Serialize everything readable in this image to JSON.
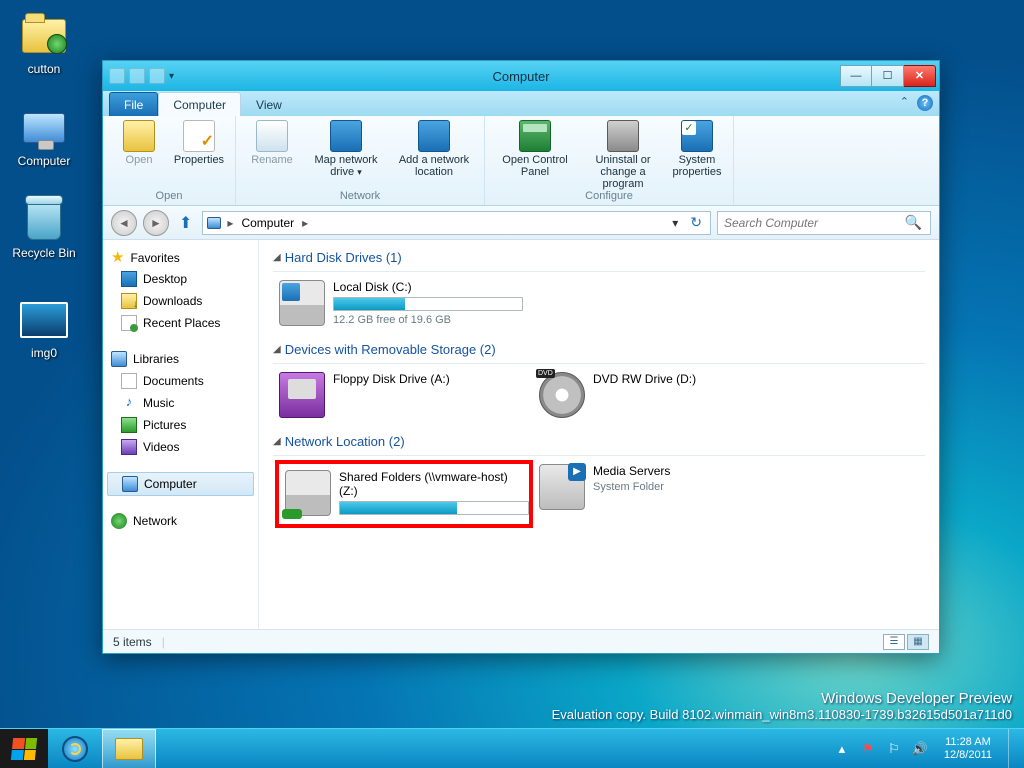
{
  "desktop": {
    "icons": [
      "cutton",
      "Computer",
      "Recycle Bin",
      "img0"
    ]
  },
  "watermark": {
    "line1": "Windows Developer Preview",
    "line2": "Evaluation copy. Build 8102.winmain_win8m3.110830-1739.b32615d501a711d0"
  },
  "taskbar": {
    "time": "11:28 AM",
    "date": "12/8/2011"
  },
  "window": {
    "title": "Computer",
    "tabs": {
      "file": "File",
      "computer": "Computer",
      "view": "View"
    },
    "ribbon": {
      "open_group": "Open",
      "open": "Open",
      "properties": "Properties",
      "rename": "Rename",
      "network_group": "Network",
      "map_drive": "Map network drive",
      "add_loc": "Add a network location",
      "configure_group": "Configure",
      "control_panel": "Open Control Panel",
      "uninstall": "Uninstall or change a program",
      "sys_props": "System properties"
    },
    "address": {
      "root": "Computer"
    },
    "search_placeholder": "Search Computer",
    "sidebar": {
      "favorites": "Favorites",
      "fav_items": [
        "Desktop",
        "Downloads",
        "Recent Places"
      ],
      "libraries": "Libraries",
      "lib_items": [
        "Documents",
        "Music",
        "Pictures",
        "Videos"
      ],
      "computer": "Computer",
      "network": "Network"
    },
    "sections": {
      "hdd": "Hard Disk Drives (1)",
      "removable": "Devices with Removable Storage (2)",
      "netloc": "Network Location (2)"
    },
    "drives": {
      "local": {
        "name": "Local Disk (C:)",
        "free_text": "12.2 GB free of 19.6 GB",
        "fill_pct": 38
      },
      "floppy": {
        "name": "Floppy Disk Drive (A:)"
      },
      "dvd": {
        "name": "DVD RW Drive (D:)",
        "badge": "DVD"
      },
      "shared": {
        "name": "Shared Folders (\\\\vmware-host) (Z:)",
        "fill_pct": 62
      },
      "media": {
        "name": "Media Servers",
        "sub": "System Folder"
      }
    },
    "status": "5 items"
  }
}
